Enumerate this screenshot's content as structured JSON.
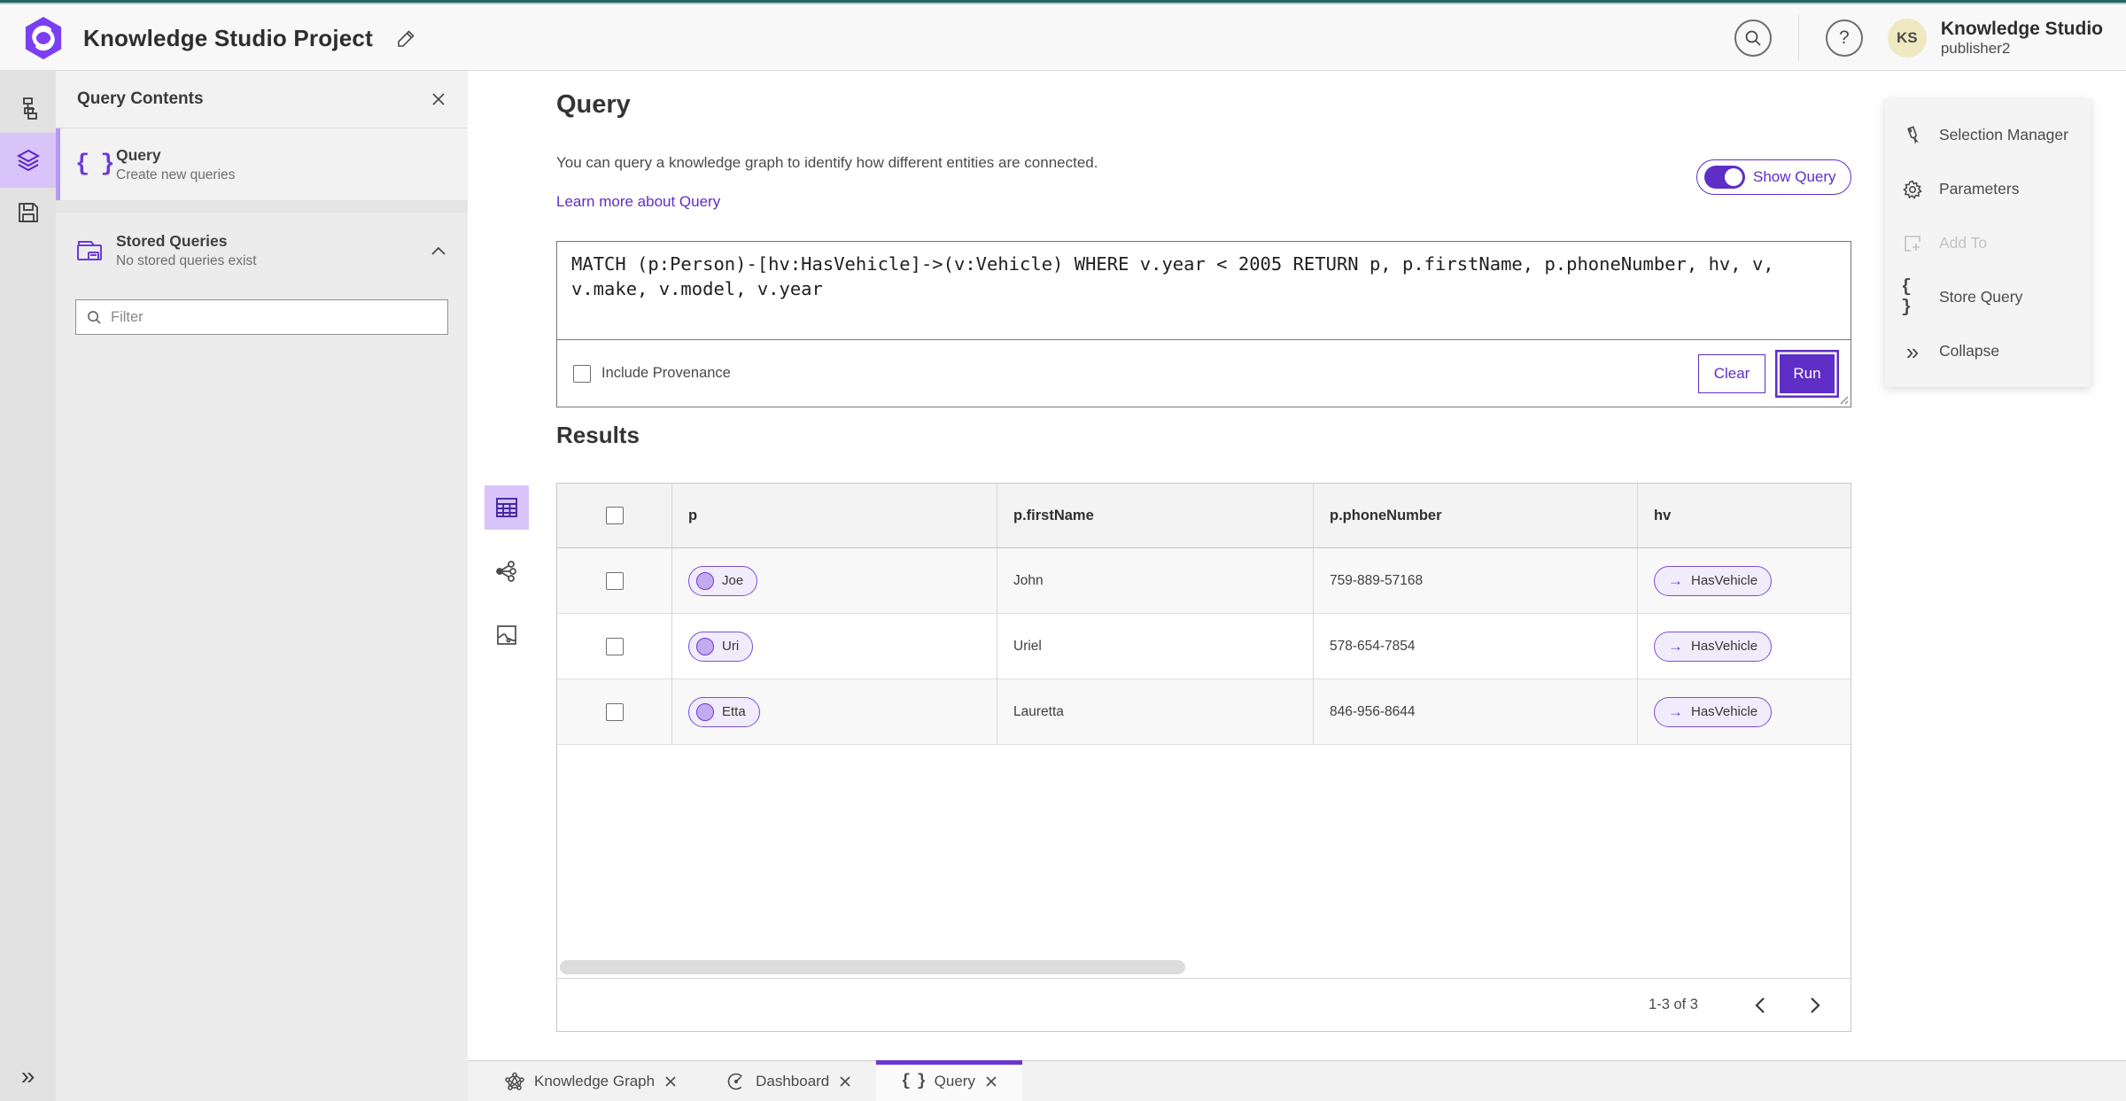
{
  "colors": {
    "accent": "#5e2ec6",
    "accent_icon": "#6d3ad6",
    "active_bg": "#d8c4f8"
  },
  "icons": {
    "help": "?",
    "braces": "{ }",
    "collapse": "»",
    "arrow_right": "→"
  },
  "header": {
    "title": "Knowledge Studio Project",
    "user_initials": "KS",
    "user_org": "Knowledge Studio",
    "user_name": "publisher2"
  },
  "left_panel": {
    "title": "Query Contents",
    "query_item": {
      "label": "Query",
      "sublabel": "Create new queries"
    },
    "stored_item": {
      "label": "Stored Queries",
      "sublabel": "No stored queries exist"
    },
    "filter_placeholder": "Filter"
  },
  "query_section": {
    "title": "Query",
    "description": "You can query a knowledge graph to identify how different entities are connected.",
    "learn_more": "Learn more about Query",
    "show_query_label": "Show Query",
    "query_text": "MATCH (p:Person)-[hv:HasVehicle]->(v:Vehicle) WHERE v.year < 2005 RETURN p, p.firstName, p.phoneNumber, hv, v, v.make, v.model, v.year",
    "include_provenance_label": "Include Provenance",
    "clear_label": "Clear",
    "run_label": "Run"
  },
  "results": {
    "title": "Results",
    "columns": [
      "p",
      "p.firstName",
      "p.phoneNumber",
      "hv"
    ],
    "rows": [
      {
        "p": "Joe",
        "firstName": "John",
        "phoneNumber": "759-889-57168",
        "hv": "HasVehicle"
      },
      {
        "p": "Uri",
        "firstName": "Uriel",
        "phoneNumber": "578-654-7854",
        "hv": "HasVehicle"
      },
      {
        "p": "Etta",
        "firstName": "Lauretta",
        "phoneNumber": "846-956-8644",
        "hv": "HasVehicle"
      }
    ],
    "pagination": "1-3 of 3"
  },
  "right_menu": {
    "items": [
      {
        "label": "Selection Manager"
      },
      {
        "label": "Parameters"
      },
      {
        "label": "Add To"
      },
      {
        "label": "Store Query"
      },
      {
        "label": "Collapse"
      }
    ]
  },
  "tabs": [
    {
      "label": "Knowledge Graph"
    },
    {
      "label": "Dashboard"
    },
    {
      "label": "Query"
    }
  ]
}
